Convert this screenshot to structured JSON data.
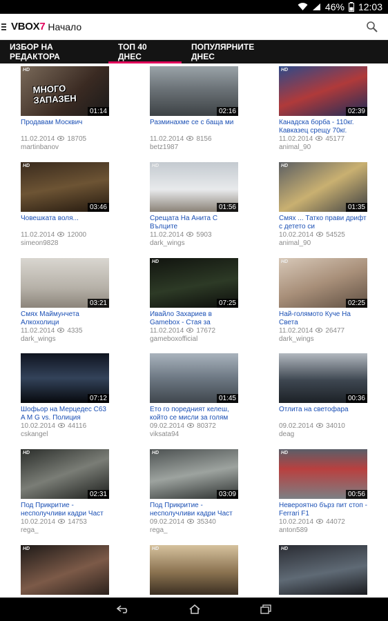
{
  "status": {
    "battery": "46%",
    "time": "12:03"
  },
  "header": {
    "logo_prefix": "VBOX",
    "logo_seven": "7",
    "title": "Начало"
  },
  "tabs": [
    {
      "label": "ИЗБОР НА РЕДАКТОРА",
      "active": false
    },
    {
      "label": "ТОП 40 ДНЕС",
      "active": true
    },
    {
      "label": "ПОПУЛЯРНИТЕ ДНЕС",
      "active": false
    }
  ],
  "colors": {
    "accent": "#e0005a",
    "link": "#1a4fb4",
    "meta": "#8a8a8a",
    "tabbar": "#141414"
  },
  "videos": [
    {
      "title": "Продавам Москвич",
      "date": "11.02.2014",
      "views": "18705",
      "author": "martinbanov",
      "duration": "01:14",
      "hd": "HD",
      "overlay": "МНОГО ЗАПАЗЕН"
    },
    {
      "title": "Разминахме се с баща ми",
      "date": "11.02.2014",
      "views": "8156",
      "author": "betz1987",
      "duration": "02:16",
      "hd": "",
      "overlay": ""
    },
    {
      "title": "Канадска борба - 110кг. Кавказец срещу 70кг.",
      "date": "11.02.2014",
      "views": "45177",
      "author": "animal_90",
      "duration": "02:39",
      "hd": "HD",
      "overlay": ""
    },
    {
      "title": "Човешката воля...",
      "date": "11.02.2014",
      "views": "12000",
      "author": "simeon9828",
      "duration": "03:46",
      "hd": "HD",
      "overlay": ""
    },
    {
      "title": "Срещата На Анита С Вълците",
      "date": "11.02.2014",
      "views": "5903",
      "author": "dark_wings",
      "duration": "01:56",
      "hd": "HD",
      "overlay": ""
    },
    {
      "title": "Смях ... Татко прави дрифт с детето си",
      "date": "10.02.2014",
      "views": "54525",
      "author": "animal_90",
      "duration": "01:35",
      "hd": "HD",
      "overlay": ""
    },
    {
      "title": "Смях Маймунчета Алкохолици",
      "date": "11.02.2014",
      "views": "4335",
      "author": "dark_wings",
      "duration": "03:21",
      "hd": "",
      "overlay": ""
    },
    {
      "title": "Ивайло Захариев в Gamebox - Стая за",
      "date": "11.02.2014",
      "views": "17672",
      "author": "gameboxofficial",
      "duration": "07:25",
      "hd": "HD",
      "overlay": ""
    },
    {
      "title": "Най-голямото Куче На Света",
      "date": "11.02.2014",
      "views": "26477",
      "author": "dark_wings",
      "duration": "02:25",
      "hd": "HD",
      "overlay": ""
    },
    {
      "title": "Шофьор на Мерцедес С63 A M G vs. Полиция",
      "date": "10.02.2014",
      "views": "44116",
      "author": "cskangel",
      "duration": "07:12",
      "hd": "",
      "overlay": ""
    },
    {
      "title": "Ето го поредният келеш, който се мисли за голям",
      "date": "09.02.2014",
      "views": "80372",
      "author": "viksata94",
      "duration": "01:45",
      "hd": "",
      "overlay": ""
    },
    {
      "title": "Отлита на светофара",
      "date": "09.02.2014",
      "views": "34010",
      "author": "deag",
      "duration": "00:36",
      "hd": "",
      "overlay": ""
    },
    {
      "title": "Под Прикритие - несполучливи кадри Част",
      "date": "10.02.2014",
      "views": "14753",
      "author": "rega_",
      "duration": "02:31",
      "hd": "HD",
      "overlay": ""
    },
    {
      "title": "Под Прикритие - несполучливи кадри Част",
      "date": "09.02.2014",
      "views": "35340",
      "author": "rega_",
      "duration": "03:09",
      "hd": "HD",
      "overlay": ""
    },
    {
      "title": "Невероятно бърз пит стоп - Ferrari F1",
      "date": "10.02.2014",
      "views": "44072",
      "author": "anton589",
      "duration": "00:56",
      "hd": "HD",
      "overlay": ""
    },
    {
      "title": "",
      "date": "",
      "views": "",
      "author": "",
      "duration": "",
      "hd": "HD",
      "overlay": ""
    },
    {
      "title": "",
      "date": "",
      "views": "",
      "author": "",
      "duration": "",
      "hd": "HD",
      "overlay": ""
    },
    {
      "title": "",
      "date": "",
      "views": "",
      "author": "",
      "duration": "",
      "hd": "HD",
      "overlay": ""
    }
  ]
}
